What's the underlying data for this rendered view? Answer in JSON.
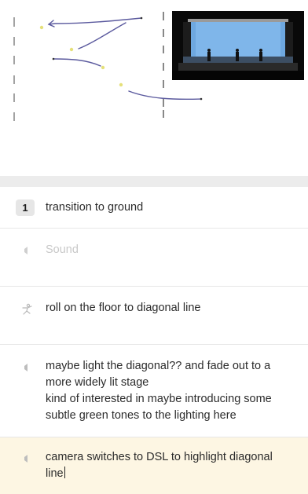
{
  "canvas": {
    "stage_preview_alt": "stage preview"
  },
  "cues": [
    {
      "number": "1",
      "text": "transition to ground",
      "icon": "cue-number-badge"
    },
    {
      "text": "Sound",
      "placeholder": true,
      "icon": "speaker-icon"
    },
    {
      "text": "roll on the floor to diagonal line",
      "icon": "dancer-icon"
    },
    {
      "lines": [
        "maybe light the diagonal?? and fade out to a",
        "more widely lit stage",
        "kind of interested in maybe introducing some",
        "subtle green tones to the lighting here"
      ],
      "icon": "speaker-icon"
    },
    {
      "lines": [
        "camera switches to DSL to highlight diagonal",
        "line"
      ],
      "icon": "speaker-icon",
      "active": true
    }
  ],
  "colors": {
    "path_stroke": "#5b5a9e",
    "marker_dot": "#e5e07a",
    "active_row_bg": "#fdf6e3",
    "stage_light": "#6ea8e0"
  }
}
